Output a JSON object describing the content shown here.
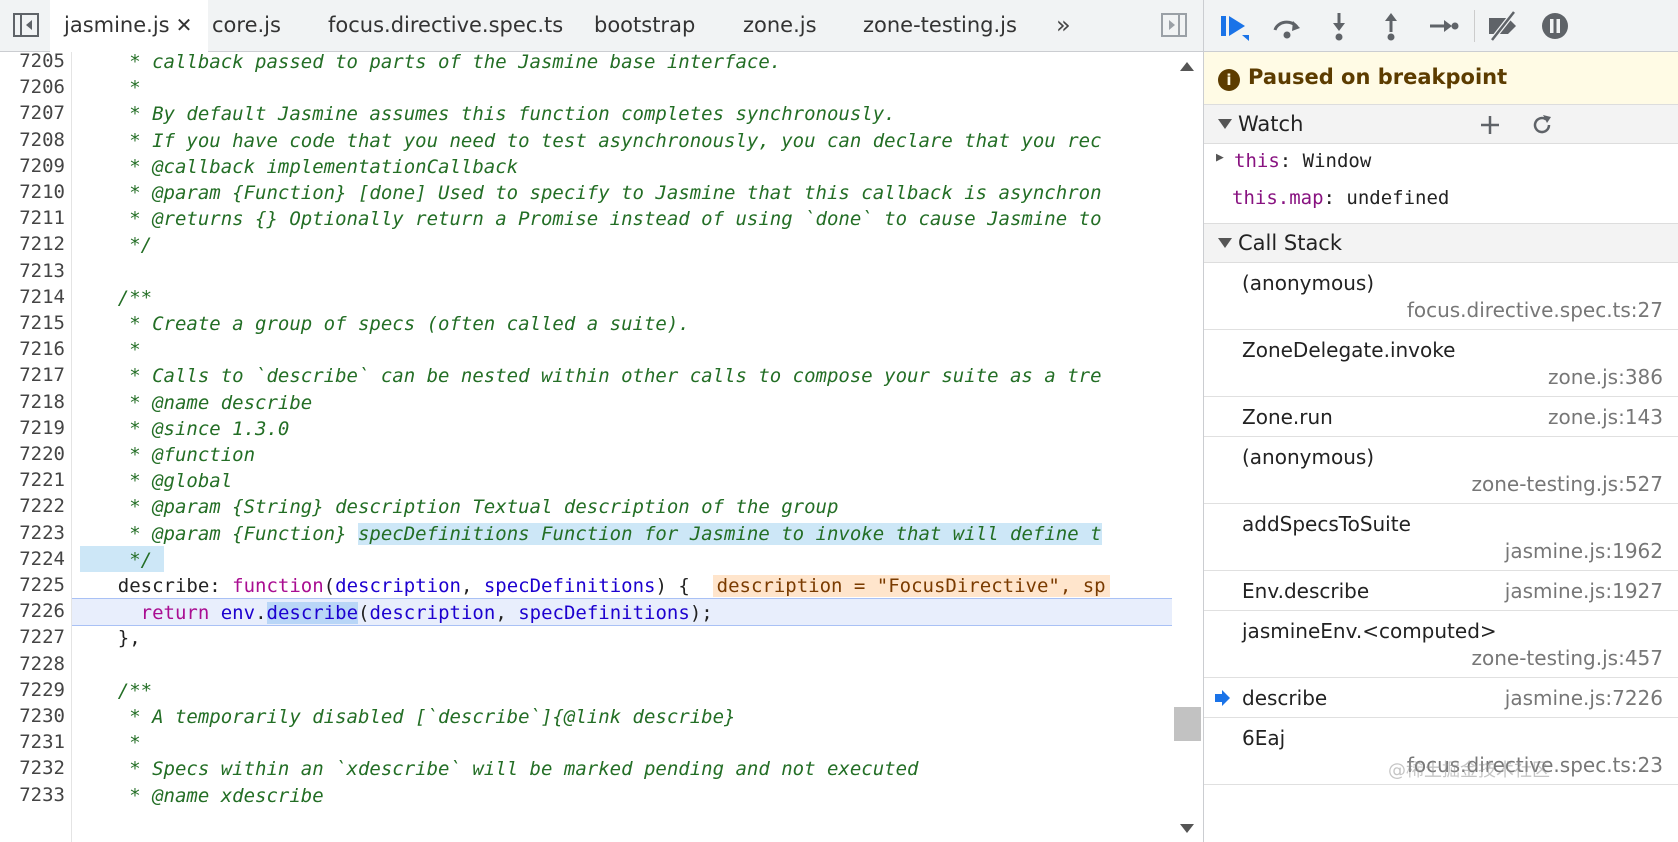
{
  "tabs": [
    {
      "label": "jasmine.js",
      "active": true
    },
    {
      "label": "core.js",
      "active": false
    },
    {
      "label": "focus.directive.spec.ts",
      "active": false
    },
    {
      "label": "bootstrap",
      "active": false
    },
    {
      "label": "zone.js",
      "active": false
    },
    {
      "label": "zone-testing.js",
      "active": false
    }
  ],
  "tabs_more_label": "»",
  "tab_close_label": "✕",
  "editor": {
    "lines": [
      {
        "n": "7205",
        "segs": [
          {
            "t": "     * callback passed to parts of the Jasmine base interface.",
            "c": "cmt"
          }
        ]
      },
      {
        "n": "7206",
        "segs": [
          {
            "t": "     *",
            "c": "cmt"
          }
        ]
      },
      {
        "n": "7207",
        "segs": [
          {
            "t": "     * By default Jasmine assumes this function completes synchronously.",
            "c": "cmt"
          }
        ]
      },
      {
        "n": "7208",
        "segs": [
          {
            "t": "     * If you have code that you need to test asynchronously, you can declare that you rec",
            "c": "cmt"
          }
        ]
      },
      {
        "n": "7209",
        "segs": [
          {
            "t": "     * @callback implementationCallback",
            "c": "cmt"
          }
        ]
      },
      {
        "n": "7210",
        "segs": [
          {
            "t": "     * @param {Function} [done] Used to specify to Jasmine that this callback is asynchron",
            "c": "cmt"
          }
        ]
      },
      {
        "n": "7211",
        "segs": [
          {
            "t": "     * @returns {} Optionally return a Promise instead of using `done` to cause Jasmine to",
            "c": "cmt"
          }
        ]
      },
      {
        "n": "7212",
        "segs": [
          {
            "t": "     */",
            "c": "cmt"
          }
        ]
      },
      {
        "n": "7213",
        "segs": [
          {
            "t": "",
            "c": "plain"
          }
        ]
      },
      {
        "n": "7214",
        "segs": [
          {
            "t": "    /**",
            "c": "cmt"
          }
        ]
      },
      {
        "n": "7215",
        "segs": [
          {
            "t": "     * Create a group of specs (often called a suite).",
            "c": "cmt"
          }
        ]
      },
      {
        "n": "7216",
        "segs": [
          {
            "t": "     *",
            "c": "cmt"
          }
        ]
      },
      {
        "n": "7217",
        "segs": [
          {
            "t": "     * Calls to `describe` can be nested within other calls to compose your suite as a tre",
            "c": "cmt"
          }
        ]
      },
      {
        "n": "7218",
        "segs": [
          {
            "t": "     * @name describe",
            "c": "cmt"
          }
        ]
      },
      {
        "n": "7219",
        "segs": [
          {
            "t": "     * @since 1.3.0",
            "c": "cmt"
          }
        ]
      },
      {
        "n": "7220",
        "segs": [
          {
            "t": "     * @function",
            "c": "cmt"
          }
        ]
      },
      {
        "n": "7221",
        "segs": [
          {
            "t": "     * @global",
            "c": "cmt"
          }
        ]
      },
      {
        "n": "7222",
        "segs": [
          {
            "t": "     * @param {String} description Textual description of the group",
            "c": "cmt"
          }
        ]
      },
      {
        "n": "7223",
        "segs": [
          {
            "t": "     * @param {Function} ",
            "c": "cmt"
          },
          {
            "t": "specDefinitions Function for Jasmine to invoke that will define t",
            "c": "cmt sel"
          }
        ]
      },
      {
        "n": "7224",
        "segs": [
          {
            "t": "     */",
            "c": "cmt sel"
          }
        ]
      },
      {
        "n": "7225",
        "segs": [
          {
            "t": "    describe: ",
            "c": "plain"
          },
          {
            "t": "function",
            "c": "kw"
          },
          {
            "t": "(",
            "c": "plain"
          },
          {
            "t": "description",
            "c": "pm"
          },
          {
            "t": ", ",
            "c": "plain"
          },
          {
            "t": "specDefinitions",
            "c": "pm"
          },
          {
            "t": ") {  ",
            "c": "plain"
          },
          {
            "t": "description = \"FocusDirective\", sp",
            "c": "inline"
          }
        ]
      },
      {
        "n": "7226",
        "segs": [
          {
            "t": "      ",
            "c": "plain"
          },
          {
            "t": "return",
            "c": "kw"
          },
          {
            "t": " ",
            "c": "plain"
          },
          {
            "t": "env",
            "c": "pm"
          },
          {
            "t": ".",
            "c": "plain"
          },
          {
            "t": "describe",
            "c": "pm word"
          },
          {
            "t": "(",
            "c": "plain"
          },
          {
            "t": "description",
            "c": "pm"
          },
          {
            "t": ", ",
            "c": "plain"
          },
          {
            "t": "specDefinitions",
            "c": "pm"
          },
          {
            "t": ");",
            "c": "plain"
          }
        ],
        "current": true
      },
      {
        "n": "7227",
        "segs": [
          {
            "t": "    },",
            "c": "plain"
          }
        ]
      },
      {
        "n": "7228",
        "segs": [
          {
            "t": "",
            "c": "plain"
          }
        ]
      },
      {
        "n": "7229",
        "segs": [
          {
            "t": "    /**",
            "c": "cmt"
          }
        ]
      },
      {
        "n": "7230",
        "segs": [
          {
            "t": "     * A temporarily disabled [`describe`]{@link describe}",
            "c": "cmt"
          }
        ]
      },
      {
        "n": "7231",
        "segs": [
          {
            "t": "     *",
            "c": "cmt"
          }
        ]
      },
      {
        "n": "7232",
        "segs": [
          {
            "t": "     * Specs within an `xdescribe` will be marked pending and not executed",
            "c": "cmt"
          }
        ]
      },
      {
        "n": "7233",
        "segs": [
          {
            "t": "     * @name xdescribe",
            "c": "cmt"
          }
        ]
      }
    ]
  },
  "debugger": {
    "paused_text": "Paused on breakpoint",
    "paused_icon_glyph": "i",
    "watch": {
      "title": "Watch",
      "items": [
        {
          "expander": "▶",
          "key": "this",
          "sep": ": ",
          "value": "Window"
        },
        {
          "expander": "",
          "key": "this.map",
          "sep": ": ",
          "value": "undefined"
        }
      ]
    },
    "call_stack": {
      "title": "Call Stack",
      "frames": [
        {
          "name": "(anonymous)",
          "location": "focus.directive.spec.ts:27",
          "two_line": true,
          "current": false
        },
        {
          "name": "ZoneDelegate.invoke",
          "location": "zone.js:386",
          "two_line": true,
          "current": false
        },
        {
          "name": "Zone.run",
          "location": "zone.js:143",
          "two_line": false,
          "current": false
        },
        {
          "name": "(anonymous)",
          "location": "zone-testing.js:527",
          "two_line": true,
          "current": false
        },
        {
          "name": "addSpecsToSuite",
          "location": "jasmine.js:1962",
          "two_line": true,
          "current": false
        },
        {
          "name": "Env.describe",
          "location": "jasmine.js:1927",
          "two_line": false,
          "current": false
        },
        {
          "name": "jasmineEnv.<computed>",
          "location": "zone-testing.js:457",
          "two_line": true,
          "current": false
        },
        {
          "name": "describe",
          "location": "jasmine.js:7226",
          "two_line": false,
          "current": true
        },
        {
          "name": "6Eaj",
          "location": "focus.directive.spec.ts:23",
          "two_line": true,
          "current": false
        }
      ]
    }
  },
  "watermark": "@稀土掘金技术社区",
  "colors": {
    "accent": "#1a73e8",
    "comment": "#236e25",
    "keyword": "#a90d91",
    "param": "#1c00cf"
  }
}
